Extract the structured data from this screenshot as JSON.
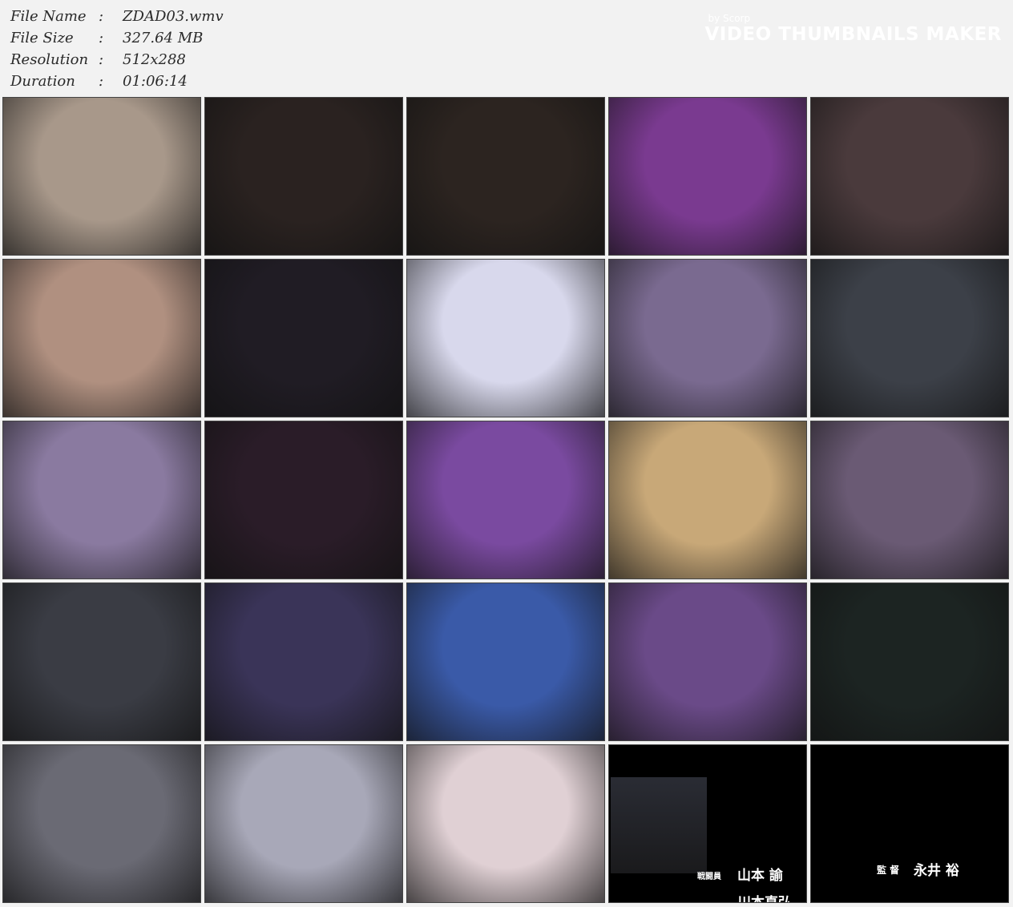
{
  "info": {
    "rows": [
      {
        "label": "File Name",
        "value": "ZDAD03.wmv"
      },
      {
        "label": "File Size",
        "value": "327.64 MB"
      },
      {
        "label": "Resolution",
        "value": "512x288"
      },
      {
        "label": "Duration",
        "value": "01:06:14"
      }
    ],
    "separator": ":"
  },
  "branding": {
    "by": "by Scorp",
    "title": "VIDEO THUMBNAILS MAKER"
  },
  "credits": {
    "thumb24_role": "戦闘員",
    "thumb24_name1": "山本 諭",
    "thumb24_name2": "川本直弘",
    "thumb25_role": "監 督",
    "thumb25_name": "永井 裕"
  },
  "thumb_colors": [
    [
      "#a8988a",
      "#2a2220",
      "#2c2420",
      "#7a3a90",
      "#4a3a3c"
    ],
    [
      "#b09080",
      "#201c24",
      "#d8d8ec",
      "#7a6a90",
      "#3c4048"
    ],
    [
      "#8a7aa0",
      "#2a1c28",
      "#7a4aa0",
      "#c8a878",
      "#6a5a74"
    ],
    [
      "#3a3c44",
      "#3a3458",
      "#3a5aa8",
      "#6a4a88",
      "#1c2422"
    ],
    [
      "#6a6a74",
      "#a8a8b8",
      "#e0d0d4",
      "#000000",
      "#000000"
    ]
  ]
}
